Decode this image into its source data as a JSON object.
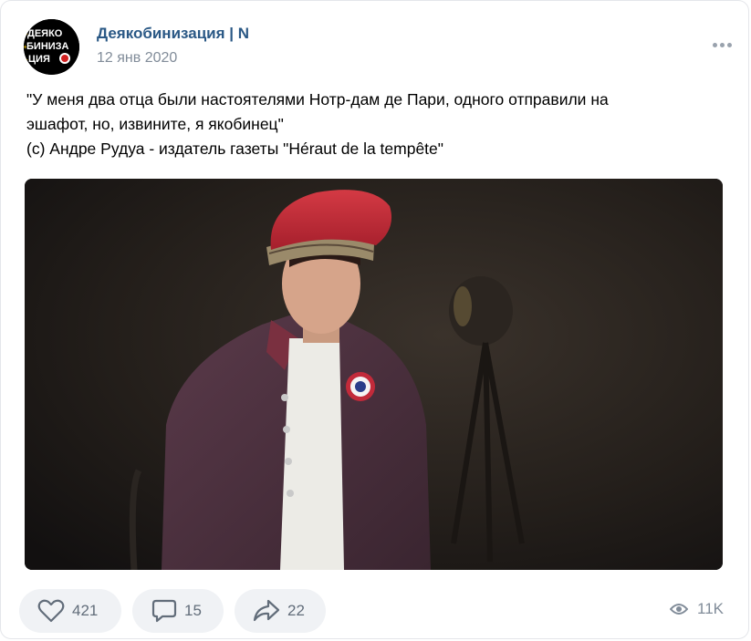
{
  "post": {
    "author": "Деякобинизация | N",
    "date": "12 янв 2020",
    "avatar_text": [
      "ДЕЯКО",
      "БИНИЗА",
      "ЦИЯ"
    ],
    "text_lines": [
      "\"У меня два отца были настоятелями Нотр-дам де Пари, одного отправили на",
      "эшафот, но, извините, я якобинец\"",
      "(с) Андре Рудуа - издатель газеты \"Héraut de la tempête\""
    ]
  },
  "actions": {
    "likes": "421",
    "comments": "15",
    "shares": "22",
    "views": "11K"
  },
  "colors": {
    "author": "#2a5885",
    "meta": "#818c99",
    "button_bg": "#f0f2f5",
    "icon": "#626d7a"
  },
  "icons": [
    "more-icon",
    "heart-icon",
    "comment-icon",
    "share-icon",
    "eye-icon"
  ]
}
